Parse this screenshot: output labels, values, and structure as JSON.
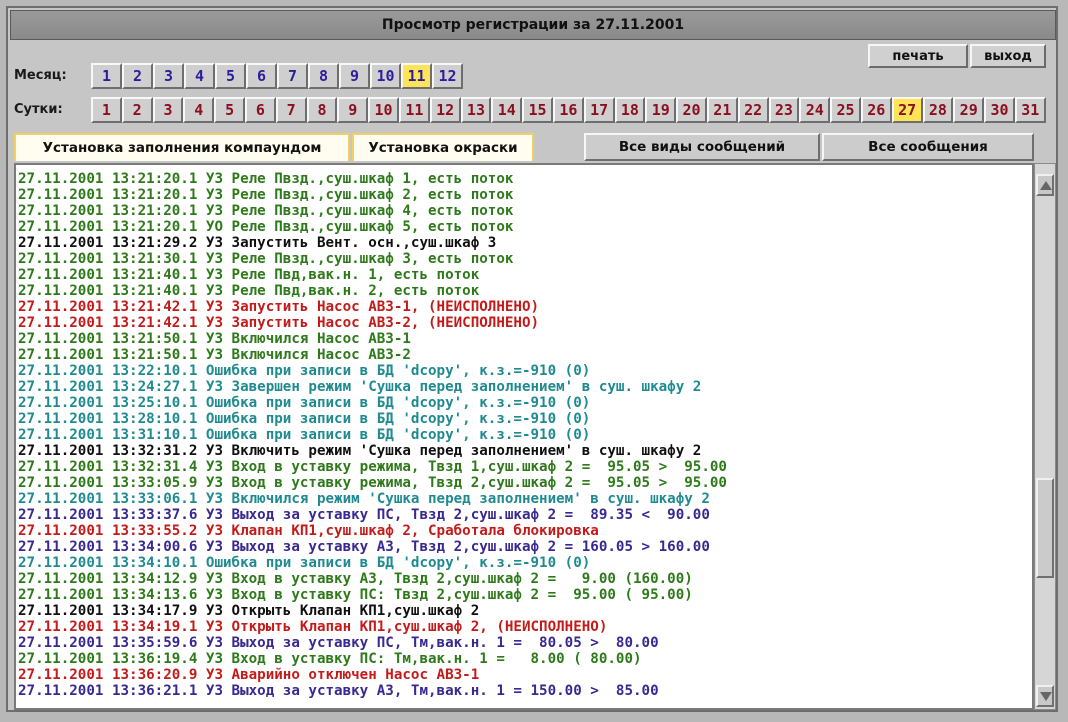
{
  "window": {
    "title": "Просмотр регистрации за 27.11.2001"
  },
  "toolbar": {
    "print_label": "печать",
    "exit_label": "выход"
  },
  "month_selector": {
    "label": "Месяц:",
    "items": [
      "1",
      "2",
      "3",
      "4",
      "5",
      "6",
      "7",
      "8",
      "9",
      "10",
      "11",
      "12"
    ],
    "selected": "11"
  },
  "day_selector": {
    "label": "Сутки:",
    "items": [
      "1",
      "2",
      "3",
      "4",
      "5",
      "6",
      "7",
      "8",
      "9",
      "10",
      "11",
      "12",
      "13",
      "14",
      "15",
      "16",
      "17",
      "18",
      "19",
      "20",
      "21",
      "22",
      "23",
      "24",
      "25",
      "26",
      "27",
      "28",
      "29",
      "30",
      "31"
    ],
    "selected": "27"
  },
  "filter_tabs": {
    "filter1": "Установка заполнения компаундом",
    "filter2": "Установка окраски",
    "all_types": "Все виды сообщений",
    "all_messages": "Все сообщения"
  },
  "colors": {
    "green": "#2e7a1a",
    "black": "#101010",
    "red": "#c41a1a",
    "teal": "#1f8a90",
    "purple": "#3a2890"
  },
  "log": [
    {
      "text": "27.11.2001 13:21:20.1 УЗ Реле Пвзд.,суш.шкаф 1, есть поток",
      "color": "green"
    },
    {
      "text": "27.11.2001 13:21:20.1 УЗ Реле Пвзд.,суш.шкаф 2, есть поток",
      "color": "green"
    },
    {
      "text": "27.11.2001 13:21:20.1 УЗ Реле Пвзд.,суш.шкаф 4, есть поток",
      "color": "green"
    },
    {
      "text": "27.11.2001 13:21:20.1 УО Реле Пвзд.,суш.шкаф 5, есть поток",
      "color": "green"
    },
    {
      "text": "27.11.2001 13:21:29.2 УЗ Запустить Вент. осн.,суш.шкаф 3",
      "color": "black"
    },
    {
      "text": "27.11.2001 13:21:30.1 УЗ Реле Пвзд.,суш.шкаф 3, есть поток",
      "color": "green"
    },
    {
      "text": "27.11.2001 13:21:40.1 УЗ Реле Пвд,вак.н. 1, есть поток",
      "color": "green"
    },
    {
      "text": "27.11.2001 13:21:40.1 УЗ Реле Пвд,вак.н. 2, есть поток",
      "color": "green"
    },
    {
      "text": "27.11.2001 13:21:42.1 УЗ Запустить Насос АВЗ-1, (НЕИСПОЛНЕНО)",
      "color": "red"
    },
    {
      "text": "27.11.2001 13:21:42.1 УЗ Запустить Насос АВЗ-2, (НЕИСПОЛНЕНО)",
      "color": "red"
    },
    {
      "text": "27.11.2001 13:21:50.1 УЗ Включился Насос АВЗ-1",
      "color": "green"
    },
    {
      "text": "27.11.2001 13:21:50.1 УЗ Включился Насос АВЗ-2",
      "color": "green"
    },
    {
      "text": "27.11.2001 13:22:10.1 Ошибка при записи в БД 'dcopy', к.з.=-910 (0)",
      "color": "teal"
    },
    {
      "text": "27.11.2001 13:24:27.1 УЗ Завершен режим 'Сушка перед заполнением' в суш. шкафу 2",
      "color": "teal"
    },
    {
      "text": "27.11.2001 13:25:10.1 Ошибка при записи в БД 'dcopy', к.з.=-910 (0)",
      "color": "teal"
    },
    {
      "text": "27.11.2001 13:28:10.1 Ошибка при записи в БД 'dcopy', к.з.=-910 (0)",
      "color": "teal"
    },
    {
      "text": "27.11.2001 13:31:10.1 Ошибка при записи в БД 'dcopy', к.з.=-910 (0)",
      "color": "teal"
    },
    {
      "text": "27.11.2001 13:32:31.2 УЗ Включить режим 'Сушка перед заполнением' в суш. шкафу 2",
      "color": "black"
    },
    {
      "text": "27.11.2001 13:32:31.4 УЗ Вход в уставку режима, Твзд 1,суш.шкаф 2 =  95.05 >  95.00",
      "color": "green"
    },
    {
      "text": "27.11.2001 13:33:05.9 УЗ Вход в уставку режима, Твзд 2,суш.шкаф 2 =  95.05 >  95.00",
      "color": "green"
    },
    {
      "text": "27.11.2001 13:33:06.1 УЗ Включился режим 'Сушка перед заполнением' в суш. шкафу 2",
      "color": "teal"
    },
    {
      "text": "27.11.2001 13:33:37.6 УЗ Выход за уставку ПС, Твзд 2,суш.шкаф 2 =  89.35 <  90.00",
      "color": "purple"
    },
    {
      "text": "27.11.2001 13:33:55.2 УЗ Клапан КП1,суш.шкаф 2, Сработала блокировка",
      "color": "red"
    },
    {
      "text": "27.11.2001 13:34:00.6 УЗ Выход за уставку АЗ, Твзд 2,суш.шкаф 2 = 160.05 > 160.00",
      "color": "purple"
    },
    {
      "text": "27.11.2001 13:34:10.1 Ошибка при записи в БД 'dcopy', к.з.=-910 (0)",
      "color": "teal"
    },
    {
      "text": "27.11.2001 13:34:12.9 УЗ Вход в уставку АЗ, Твзд 2,суш.шкаф 2 =   9.00 (160.00)",
      "color": "green"
    },
    {
      "text": "27.11.2001 13:34:13.6 УЗ Вход в уставку ПС: Твзд 2,суш.шкаф 2 =  95.00 ( 95.00)",
      "color": "green"
    },
    {
      "text": "27.11.2001 13:34:17.9 УЗ Открыть Клапан КП1,суш.шкаф 2",
      "color": "black"
    },
    {
      "text": "27.11.2001 13:34:19.1 УЗ Открыть Клапан КП1,суш.шкаф 2, (НЕИСПОЛНЕНО)",
      "color": "red"
    },
    {
      "text": "27.11.2001 13:35:59.6 УЗ Выход за уставку ПС, Тм,вак.н. 1 =  80.05 >  80.00",
      "color": "purple"
    },
    {
      "text": "27.11.2001 13:36:19.4 УЗ Вход в уставку ПС: Тм,вак.н. 1 =   8.00 ( 80.00)",
      "color": "green"
    },
    {
      "text": "27.11.2001 13:36:20.9 УЗ Аварийно отключен Насос АВЗ-1",
      "color": "red"
    },
    {
      "text": "27.11.2001 13:36:21.1 УЗ Выход за уставку АЗ, Тм,вак.н. 1 = 150.00 >  85.00",
      "color": "purple"
    }
  ],
  "scrollbar": {
    "position": 0.72
  }
}
